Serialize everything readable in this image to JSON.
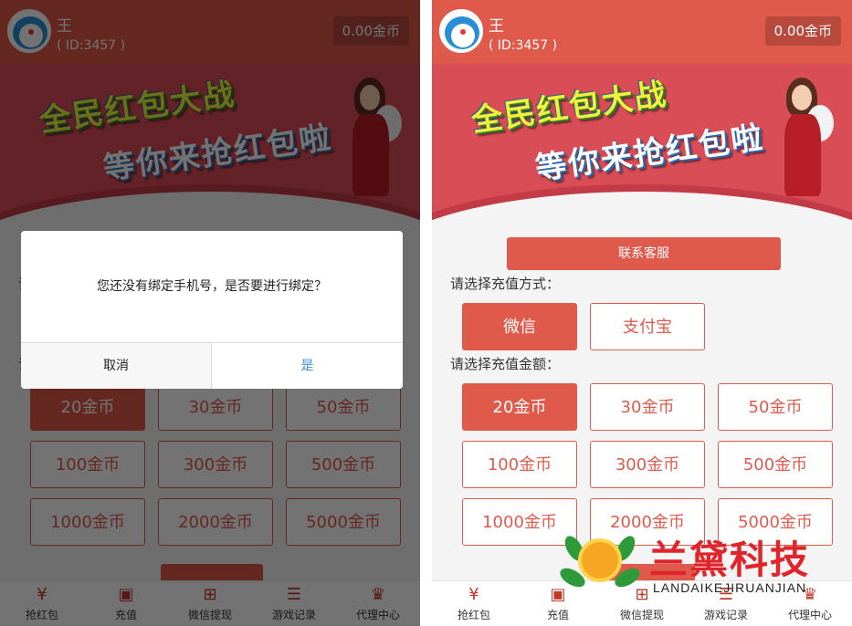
{
  "user": {
    "name": "王",
    "id_text": "( ID:3457 )",
    "balance": "0.00金币"
  },
  "banner": {
    "line1": "全民红包大战",
    "line2": "等你来抢红包啦"
  },
  "service_button": "联系客服",
  "method_label": "请选择充值方式：",
  "methods": [
    {
      "label": "微信",
      "active": true
    },
    {
      "label": "支付宝",
      "active": false
    }
  ],
  "amount_label": "请选择充值金额：",
  "amounts": [
    {
      "label": "20金币",
      "active": true
    },
    {
      "label": "30金币",
      "active": false
    },
    {
      "label": "50金币",
      "active": false
    },
    {
      "label": "100金币",
      "active": false
    },
    {
      "label": "300金币",
      "active": false
    },
    {
      "label": "500金币",
      "active": false
    },
    {
      "label": "1000金币",
      "active": false
    },
    {
      "label": "2000金币",
      "active": false
    },
    {
      "label": "5000金币",
      "active": false
    }
  ],
  "nav": [
    {
      "label": "抢红包",
      "icon": "money-bag-icon",
      "glyph": "¥"
    },
    {
      "label": "充值",
      "icon": "recharge-icon",
      "glyph": "▣"
    },
    {
      "label": "微信提现",
      "icon": "gift-icon",
      "glyph": "⊞"
    },
    {
      "label": "游戏记录",
      "icon": "list-icon",
      "glyph": "☰"
    },
    {
      "label": "代理中心",
      "icon": "crown-icon",
      "glyph": "♛"
    }
  ],
  "dialog": {
    "message": "您还没有绑定手机号，是否要进行绑定？",
    "cancel": "取消",
    "confirm": "是"
  },
  "watermark": {
    "title": "兰黛科技",
    "subtitle": "LANDAIKEJIRUANJIAN"
  },
  "colors": {
    "accent": "#e05a4b",
    "link": "#3a8fd6"
  }
}
